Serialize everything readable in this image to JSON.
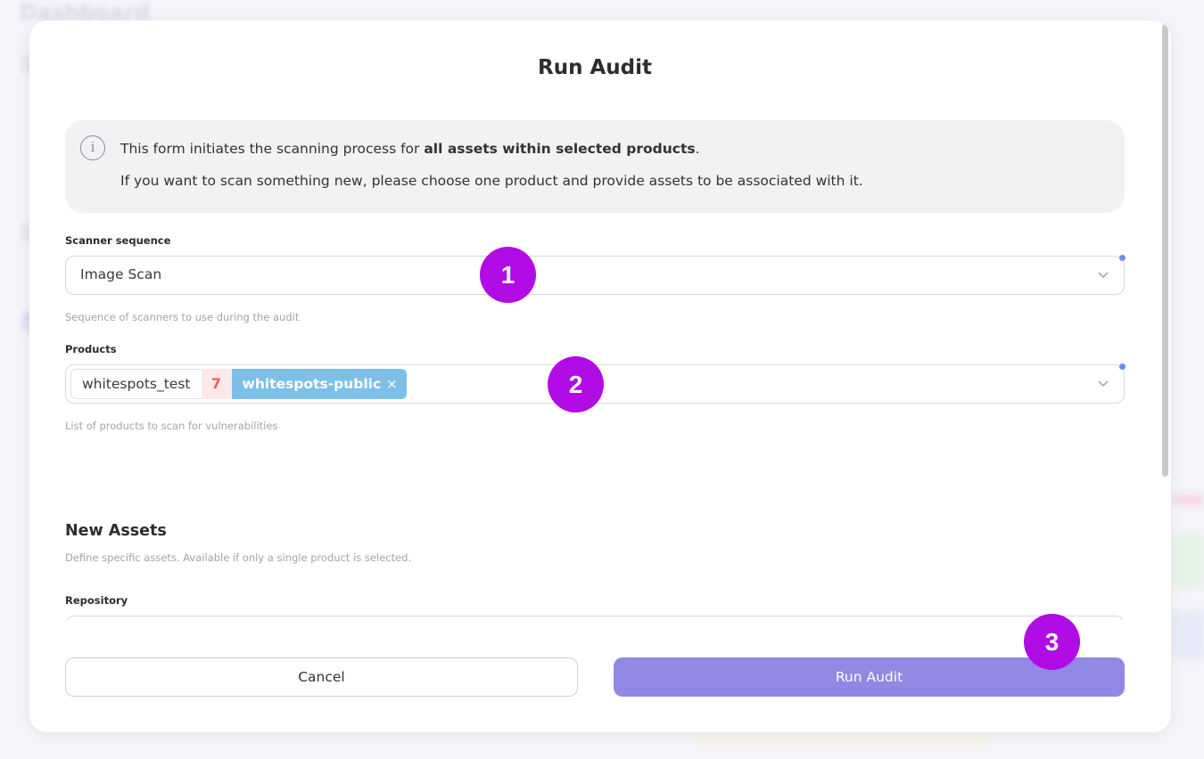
{
  "background": {
    "page_title": "Dashboard"
  },
  "modal": {
    "title": "Run Audit",
    "info": {
      "line1_prefix": "This form initiates the scanning process for ",
      "line1_bold": "all assets within selected products",
      "line1_suffix": ".",
      "line2": "If you want to scan something new, please choose one product and provide assets to be associated with it."
    },
    "scanner_sequence": {
      "label": "Scanner sequence",
      "value": "Image Scan",
      "helper": "Sequence of scanners to use during the audit"
    },
    "products": {
      "label": "Products",
      "tag_plain": "whitespots_test",
      "tag_count": "7",
      "tag_selected": "whitespots-public",
      "remove_glyph": "×",
      "helper": "List of products to scan for vulnerabilities"
    },
    "new_assets": {
      "title": "New Assets",
      "description": "Define specific assets. Available if only a single product is selected.",
      "repository_label": "Repository"
    },
    "buttons": {
      "cancel": "Cancel",
      "run": "Run Audit"
    }
  },
  "markers": [
    "1",
    "2",
    "3"
  ],
  "colors": {
    "accent": "#9088e3",
    "marker": "#b10be6",
    "tag_selected": "#7dbfe6",
    "tag_count_text": "#ef5a5a",
    "focus_dot": "#6b8ef3"
  }
}
